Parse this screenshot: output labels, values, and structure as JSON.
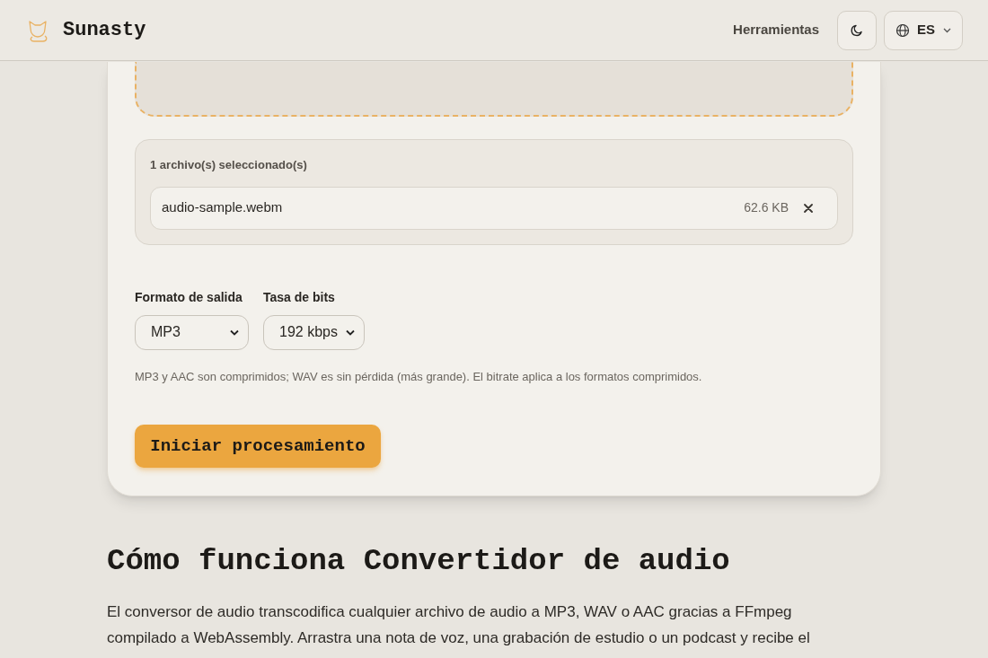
{
  "header": {
    "brand": "Sunasty",
    "nav_link": "Herramientas",
    "language": "ES"
  },
  "files": {
    "title": "1 archivo(s) seleccionado(s)",
    "items": [
      {
        "name": "audio-sample.webm",
        "size": "62.6 KB"
      }
    ]
  },
  "settings": [
    {
      "label": "Formato de salida",
      "value": "MP3"
    },
    {
      "label": "Tasa de bits",
      "value": "192 kbps"
    }
  ],
  "note": "MP3 y AAC son comprimidos; WAV es sin pérdida (más grande). El bitrate aplica a los formatos comprimidos.",
  "start_button": "Iniciar procesamiento",
  "section": {
    "heading": "Cómo funciona Convertidor de audio",
    "paragraph": "El conversor de audio transcodifica cualquier archivo de audio a MP3, WAV o AAC gracias a FFmpeg compilado a WebAssembly. Arrastra una nota de voz, una grabación de estudio o un podcast y recibe el"
  }
}
